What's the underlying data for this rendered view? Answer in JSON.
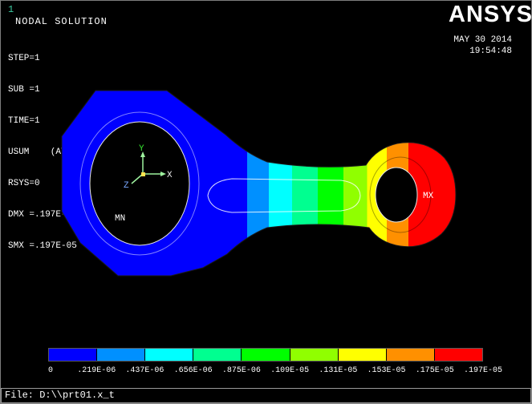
{
  "window": {
    "plot_number": "1",
    "title": "NODAL SOLUTION",
    "info_lines": [
      "STEP=1",
      "SUB =1",
      "TIME=1",
      "USUM    (AVG)",
      "RSYS=0",
      "DMX =.197E-05",
      "SMX =.197E-05"
    ],
    "logo": "ANSYS",
    "date": "MAY 30 2014",
    "time": "19:54:48"
  },
  "plot": {
    "min_label": "MN",
    "max_label": "MX",
    "triad": {
      "x": "X",
      "y": "Y",
      "z": "Z"
    },
    "band_fractions": [
      0,
      0.47,
      0.525,
      0.585,
      0.65,
      0.715,
      0.775,
      0.825,
      0.88,
      1
    ]
  },
  "legend": {
    "values": [
      "0",
      ".219E-06",
      ".437E-06",
      ".656E-06",
      ".875E-06",
      ".109E-05",
      ".131E-05",
      ".153E-05",
      ".175E-05",
      ".197E-05"
    ],
    "colors": [
      "#0000ff",
      "#0090ff",
      "#00ffff",
      "#00ff90",
      "#00ff00",
      "#90ff00",
      "#ffff00",
      "#ff9000",
      "#ff0000"
    ]
  },
  "statusbar": {
    "text": "File: D:\\\\prt01.x_t"
  }
}
